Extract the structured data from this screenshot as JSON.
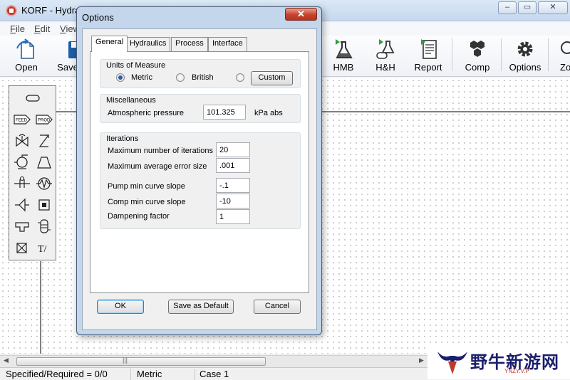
{
  "app": {
    "title": "KORF - Hydra",
    "menu": [
      "File",
      "Edit",
      "View"
    ],
    "window_controls": [
      "minimize",
      "restore",
      "close"
    ]
  },
  "toolbar": {
    "left": [
      {
        "label": "Open",
        "icon": "open-file-icon"
      },
      {
        "label": "Save",
        "icon": "save-icon"
      }
    ],
    "right": [
      {
        "label": "HMB",
        "icon": "flask-play-icon"
      },
      {
        "label": "H&H",
        "icon": "pipe-play-icon"
      },
      {
        "label": "Report",
        "icon": "report-icon"
      },
      {
        "label": "Comp",
        "icon": "components-icon"
      },
      {
        "label": "Options",
        "icon": "gear-icon"
      },
      {
        "label": "Zo",
        "icon": "zoom-icon"
      }
    ]
  },
  "palette": {
    "items": [
      "pipe-icon",
      "feed-icon",
      "product-icon",
      "valve-icon",
      "control-valve-icon",
      "pump-icon",
      "compressor-icon",
      "orifice-icon",
      "heat-exchanger-icon",
      "nozzle-icon",
      "equipment-icon",
      "tee-icon",
      "vessel-icon",
      "misc-icon",
      "text-tool-icon"
    ],
    "feed_label": "FEED",
    "prod_label": "PROD",
    "text_tool": "T/"
  },
  "status": {
    "specified": "Specified/Required = 0/0",
    "units": "Metric",
    "case": "Case 1"
  },
  "watermark": {
    "text": "野牛新游网",
    "sub": "YNZY.V.P"
  },
  "dialog": {
    "title": "Options",
    "tabs": [
      "General",
      "Hydraulics",
      "Process",
      "Interface"
    ],
    "active_tab": "General",
    "units": {
      "title": "Units of Measure",
      "options": [
        "Metric",
        "British",
        ""
      ],
      "selected": "Metric",
      "custom_button": "Custom"
    },
    "misc": {
      "title": "Miscellaneous",
      "atm_label": "Atmospheric pressure",
      "atm_value": "101.325",
      "atm_unit": "kPa abs"
    },
    "iterations": {
      "title": "Iterations",
      "fields": [
        {
          "label": "Maximum number of iterations",
          "value": "20"
        },
        {
          "label": "Maximum average error size",
          "value": ".001"
        },
        {
          "label": "Pump min curve slope",
          "value": "-.1"
        },
        {
          "label": "Comp min curve slope",
          "value": "-10"
        },
        {
          "label": "Dampening factor",
          "value": "1"
        }
      ]
    },
    "buttons": {
      "ok": "OK",
      "save_default": "Save as Default",
      "cancel": "Cancel"
    }
  }
}
